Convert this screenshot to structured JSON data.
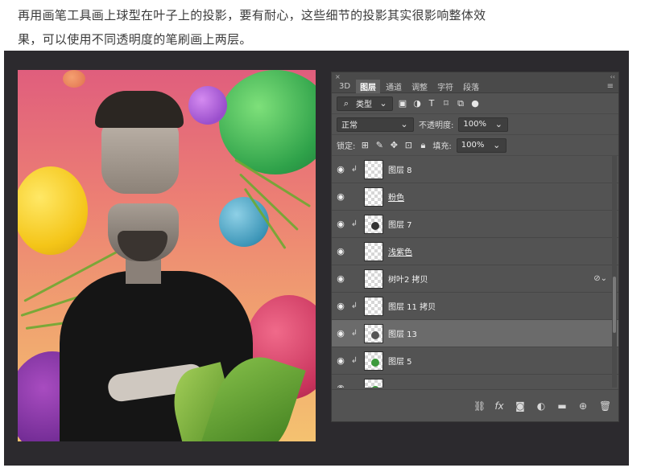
{
  "intro": {
    "line1": "再用画笔工具画上球型在叶子上的投影，要有耐心，这些细节的投影其实很影响整体效",
    "line2": "果，可以使用不同透明度的笔刷画上两层。"
  },
  "panel": {
    "strip_left": "×",
    "strip_right": "‹‹",
    "tabs": [
      "3D",
      "图层",
      "通道",
      "调整",
      "字符",
      "段落"
    ],
    "active_tab": "图层",
    "filter_kind": "类型",
    "blend_mode": "正常",
    "opacity_label": "不透明度:",
    "opacity_value": "100%",
    "lock_label": "锁定:",
    "fill_label": "填充:",
    "fill_value": "100%",
    "layers": [
      {
        "name": "图层 8",
        "clipped": true,
        "selected": false,
        "underline": false,
        "thumb_accent": ""
      },
      {
        "name": "粉色",
        "clipped": false,
        "selected": false,
        "underline": true,
        "thumb_accent": ""
      },
      {
        "name": "图层 7",
        "clipped": true,
        "selected": false,
        "underline": false,
        "thumb_accent": "#333333"
      },
      {
        "name": "浅紫色",
        "clipped": false,
        "selected": false,
        "underline": true,
        "thumb_accent": ""
      },
      {
        "name": "树叶2 拷贝",
        "clipped": false,
        "selected": false,
        "underline": false,
        "thumb_accent": ""
      },
      {
        "name": "图层 11 拷贝",
        "clipped": true,
        "selected": false,
        "underline": false,
        "thumb_accent": ""
      },
      {
        "name": "图层 13",
        "clipped": true,
        "selected": true,
        "underline": false,
        "thumb_accent": "#555555"
      },
      {
        "name": "图层 5",
        "clipped": true,
        "selected": false,
        "underline": false,
        "thumb_accent": "#3c9a3c"
      },
      {
        "name": "",
        "clipped": false,
        "selected": false,
        "underline": false,
        "thumb_accent": "#3c9a3c"
      }
    ]
  }
}
